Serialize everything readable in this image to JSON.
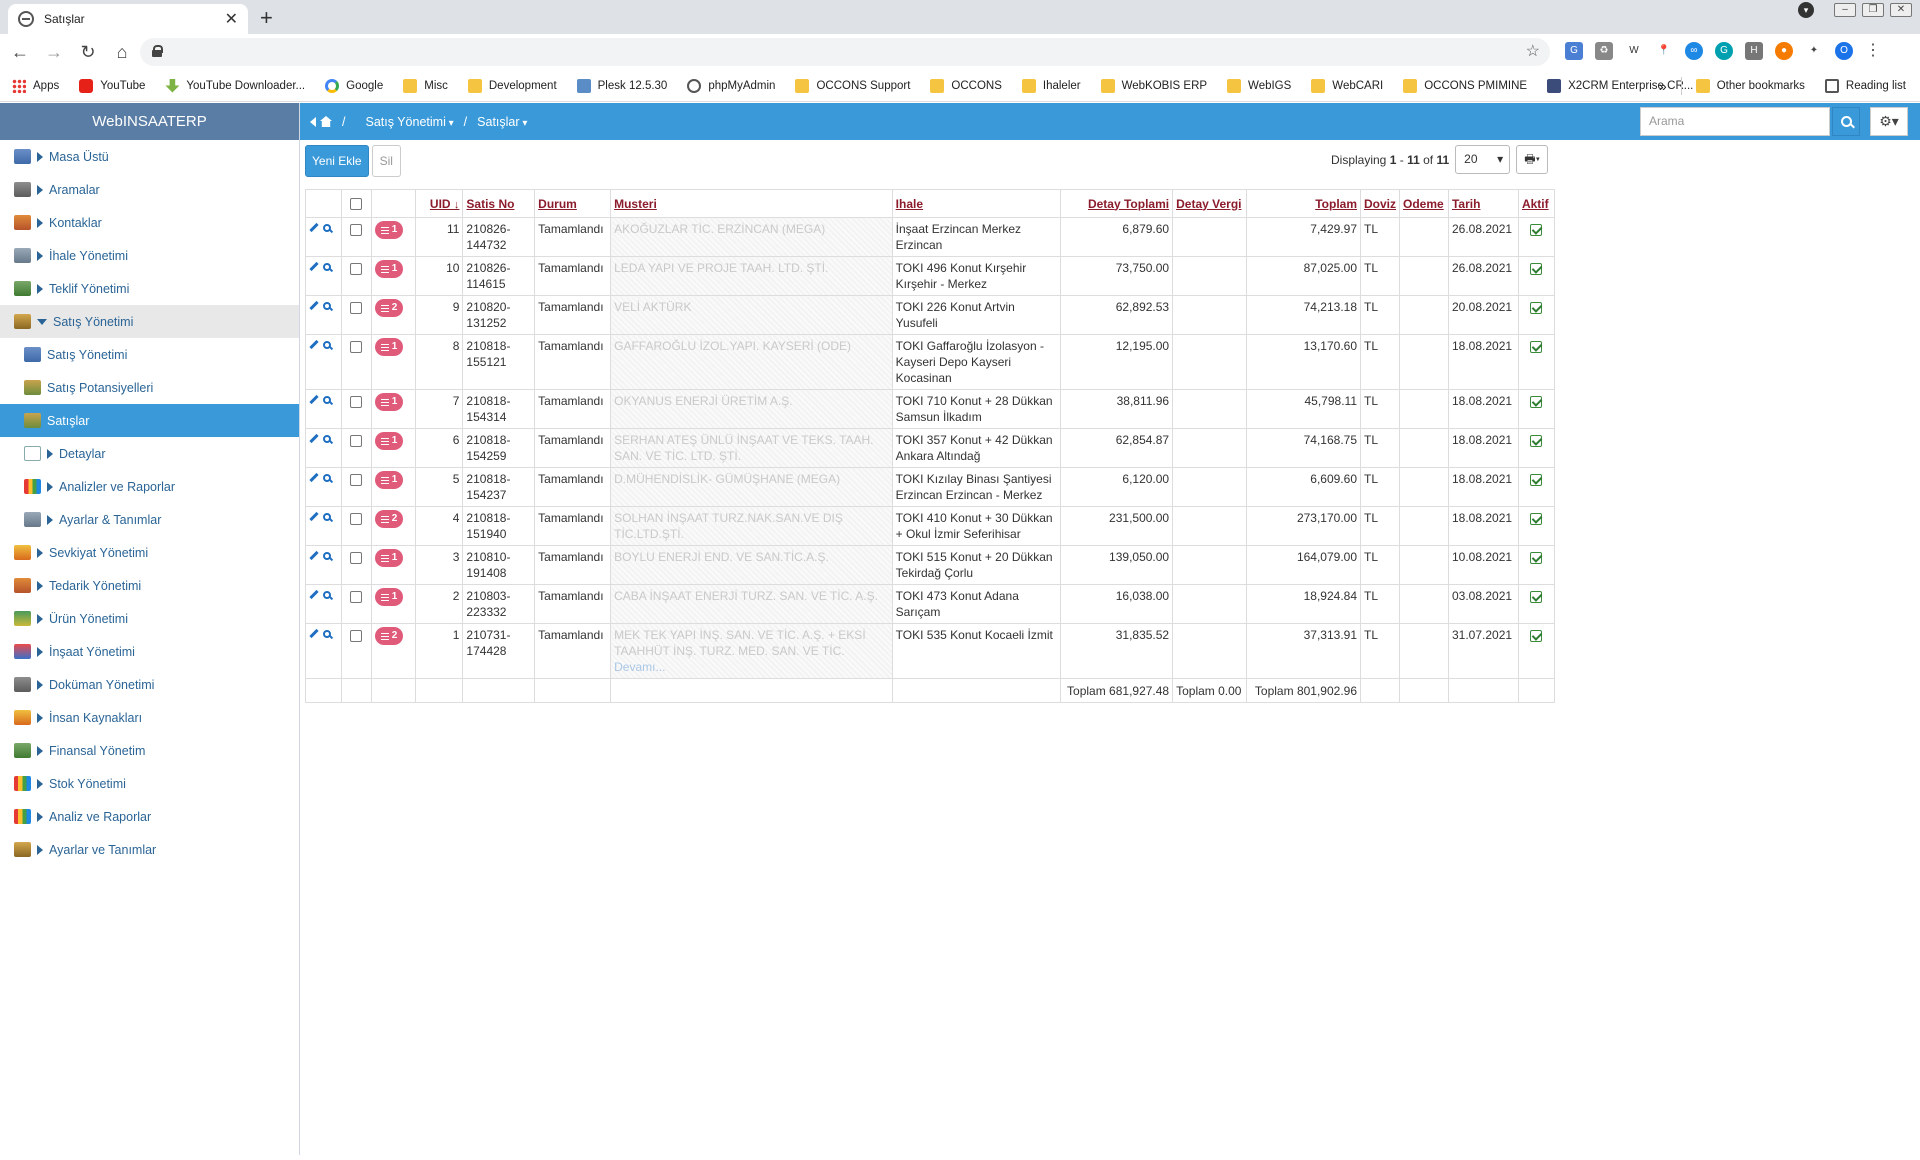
{
  "browser": {
    "tab_title": "Satışlar",
    "bookmarks": [
      {
        "label": "Apps",
        "icon": "grid"
      },
      {
        "label": "YouTube",
        "icon": "yt"
      },
      {
        "label": "YouTube Downloader...",
        "icon": "ytd"
      },
      {
        "label": "Google",
        "icon": "g"
      },
      {
        "label": "Misc",
        "icon": "folder"
      },
      {
        "label": "Development",
        "icon": "folder"
      },
      {
        "label": "Plesk 12.5.30",
        "icon": "plesk"
      },
      {
        "label": "phpMyAdmin",
        "icon": "pma"
      },
      {
        "label": "OCCONS Support",
        "icon": "folder"
      },
      {
        "label": "OCCONS",
        "icon": "folder"
      },
      {
        "label": "Ihaleler",
        "icon": "folder"
      },
      {
        "label": "WebKOBIS ERP",
        "icon": "folder"
      },
      {
        "label": "WebIGS",
        "icon": "folder"
      },
      {
        "label": "WebCARI",
        "icon": "folder"
      },
      {
        "label": "OCCONS PMIMINE",
        "icon": "folder"
      },
      {
        "label": "X2CRM Enterprise CR...",
        "icon": "x2"
      }
    ],
    "overflow": "»",
    "other_bookmarks": "Other bookmarks",
    "reading_list": "Reading list",
    "profile_initial": "O"
  },
  "app": {
    "brand": "WebINSAATERP",
    "menu": [
      {
        "label": "Masa Üstü",
        "icon": "c1",
        "level": 0,
        "state": ""
      },
      {
        "label": "Aramalar",
        "icon": "c2",
        "level": 0,
        "state": ""
      },
      {
        "label": "Kontaklar",
        "icon": "c3",
        "level": 0,
        "state": ""
      },
      {
        "label": "İhale Yönetimi",
        "icon": "c4",
        "level": 0,
        "state": ""
      },
      {
        "label": "Teklif Yönetimi",
        "icon": "c5",
        "level": 0,
        "state": ""
      },
      {
        "label": "Satış Yönetimi",
        "icon": "c6",
        "level": 0,
        "state": "open"
      },
      {
        "label": "Satış Yönetimi",
        "icon": "c1",
        "level": 1,
        "state": "leaf"
      },
      {
        "label": "Satış Potansiyelleri",
        "icon": "c7",
        "level": 1,
        "state": "leaf"
      },
      {
        "label": "Satışlar",
        "icon": "c7",
        "level": 1,
        "state": "selected"
      },
      {
        "label": "Detaylar",
        "icon": "doc",
        "level": 1,
        "state": ""
      },
      {
        "label": "Analizler ve Raporlar",
        "icon": "chart",
        "level": 1,
        "state": ""
      },
      {
        "label": "Ayarlar & Tanımlar",
        "icon": "c4",
        "level": 1,
        "state": ""
      },
      {
        "label": "Sevkiyat Yönetimi",
        "icon": "c8",
        "level": 0,
        "state": ""
      },
      {
        "label": "Tedarik Yönetimi",
        "icon": "c3",
        "level": 0,
        "state": ""
      },
      {
        "label": "Ürün Yönetimi",
        "icon": "c10",
        "level": 0,
        "state": ""
      },
      {
        "label": "İnşaat Yönetimi",
        "icon": "c9",
        "level": 0,
        "state": ""
      },
      {
        "label": "Doküman Yönetimi",
        "icon": "c2",
        "level": 0,
        "state": ""
      },
      {
        "label": "İnsan Kaynakları",
        "icon": "c8",
        "level": 0,
        "state": ""
      },
      {
        "label": "Finansal Yönetim",
        "icon": "c5",
        "level": 0,
        "state": ""
      },
      {
        "label": "Stok Yönetimi",
        "icon": "chart",
        "level": 0,
        "state": ""
      },
      {
        "label": "Analiz ve Raporlar",
        "icon": "chart",
        "level": 0,
        "state": ""
      },
      {
        "label": "Ayarlar ve Tanımlar",
        "icon": "c6",
        "level": 0,
        "state": ""
      }
    ],
    "breadcrumb": {
      "section": "Satış Yönetimi",
      "page": "Satışlar",
      "sep": "/"
    },
    "search_placeholder": "Arama",
    "settings_label": "⚙▾",
    "new_button": "Yeni Ekle",
    "delete_button": "Sil",
    "pager": {
      "prefix": "Displaying",
      "from": "1",
      "dash": "-",
      "to": "11",
      "of": "of",
      "total": "11",
      "page_size": "20"
    },
    "print_label": "🖶▾",
    "columns": [
      "UID",
      "Satis No",
      "Durum",
      "Musteri",
      "Ihale",
      "Detay Toplami",
      "Detay Vergi",
      "Toplam",
      "Doviz",
      "Odeme",
      "Tarih",
      "Aktif"
    ],
    "rows": [
      {
        "badge": "1",
        "uid": "11",
        "no": "210826-144732",
        "durum": "Tamamlandı",
        "musteri": "AKOĞUZLAR TİC. ERZİNCAN (MEGA)",
        "ihale": "İnşaat Erzincan Merkez Erzincan",
        "detay": "6,879.60",
        "vergi": "",
        "toplam": "7,429.97",
        "doviz": "TL",
        "odeme": "",
        "tarih": "26.08.2021"
      },
      {
        "badge": "1",
        "uid": "10",
        "no": "210826-114615",
        "durum": "Tamamlandı",
        "musteri": "LEDA YAPI VE PROJE TAAH. LTD. ŞTİ.",
        "ihale": "TOKI 496 Konut Kırşehir Kırşehir - Merkez",
        "detay": "73,750.00",
        "vergi": "",
        "toplam": "87,025.00",
        "doviz": "TL",
        "odeme": "",
        "tarih": "26.08.2021"
      },
      {
        "badge": "2",
        "uid": "9",
        "no": "210820-131252",
        "durum": "Tamamlandı",
        "musteri": "VELİ AKTÜRK",
        "ihale": "TOKI 226 Konut Artvin Yusufeli",
        "detay": "62,892.53",
        "vergi": "",
        "toplam": "74,213.18",
        "doviz": "TL",
        "odeme": "",
        "tarih": "20.08.2021"
      },
      {
        "badge": "1",
        "uid": "8",
        "no": "210818-155121",
        "durum": "Tamamlandı",
        "musteri": "GAFFAROĞLU İZOL.YAPI. KAYSERİ (ODE)",
        "ihale": "TOKI Gaffaroğlu İzolasyon - Kayseri Depo Kayseri Kocasinan",
        "detay": "12,195.00",
        "vergi": "",
        "toplam": "13,170.60",
        "doviz": "TL",
        "odeme": "",
        "tarih": "18.08.2021"
      },
      {
        "badge": "1",
        "uid": "7",
        "no": "210818-154314",
        "durum": "Tamamlandı",
        "musteri": "OKYANUS ENERJİ ÜRETİM A.Ş.",
        "ihale": "TOKI 710 Konut + 28 Dükkan Samsun İlkadım",
        "detay": "38,811.96",
        "vergi": "",
        "toplam": "45,798.11",
        "doviz": "TL",
        "odeme": "",
        "tarih": "18.08.2021"
      },
      {
        "badge": "1",
        "uid": "6",
        "no": "210818-154259",
        "durum": "Tamamlandı",
        "musteri": "SERHAN ATEŞ ÜNLÜ İNŞAAT VE TEKS. TAAH. SAN. VE TİC. LTD. ŞTİ.",
        "ihale": "TOKI 357 Konut + 42 Dükkan Ankara Altındağ",
        "detay": "62,854.87",
        "vergi": "",
        "toplam": "74,168.75",
        "doviz": "TL",
        "odeme": "",
        "tarih": "18.08.2021"
      },
      {
        "badge": "1",
        "uid": "5",
        "no": "210818-154237",
        "durum": "Tamamlandı",
        "musteri": "D.MÜHENDİSLİK- GÜMÜŞHANE (MEGA)",
        "ihale": "TOKI Kızılay Binası Şantiyesi Erzincan Erzincan - Merkez",
        "detay": "6,120.00",
        "vergi": "",
        "toplam": "6,609.60",
        "doviz": "TL",
        "odeme": "",
        "tarih": "18.08.2021"
      },
      {
        "badge": "2",
        "uid": "4",
        "no": "210818-151940",
        "durum": "Tamamlandı",
        "musteri": "SOLHAN İNŞAAT TURZ.NAK.SAN.VE DIŞ TİC.LTD.ŞTİ.",
        "ihale": "TOKI 410 Konut + 30 Dükkan + Okul İzmir Seferihisar",
        "detay": "231,500.00",
        "vergi": "",
        "toplam": "273,170.00",
        "doviz": "TL",
        "odeme": "",
        "tarih": "18.08.2021"
      },
      {
        "badge": "1",
        "uid": "3",
        "no": "210810-191408",
        "durum": "Tamamlandı",
        "musteri": "BOYLU ENERJİ END. VE SAN.TİC.A.Ş.",
        "ihale": "TOKI 515 Konut + 20 Dükkan Tekirdağ Çorlu",
        "detay": "139,050.00",
        "vergi": "",
        "toplam": "164,079.00",
        "doviz": "TL",
        "odeme": "",
        "tarih": "10.08.2021"
      },
      {
        "badge": "1",
        "uid": "2",
        "no": "210803-223332",
        "durum": "Tamamlandı",
        "musteri": "CABA İNŞAAT ENERJİ TURZ. SAN. VE TİC. A.Ş.",
        "ihale": "TOKI 473 Konut Adana Sarıçam",
        "detay": "16,038.00",
        "vergi": "",
        "toplam": "18,924.84",
        "doviz": "TL",
        "odeme": "",
        "tarih": "03.08.2021"
      },
      {
        "badge": "2",
        "uid": "1",
        "no": "210731-174428",
        "durum": "Tamamlandı",
        "musteri": "MEK TEK YAPI İNŞ. SAN. VE TİC. A.Ş. + EKSİ TAAHHÜT İNŞ. TURZ. MED. SAN. VE TİC.",
        "more": "Devamı...",
        "ihale": "TOKI 535 Konut Kocaeli İzmit",
        "detay": "31,835.52",
        "vergi": "",
        "toplam": "37,313.91",
        "doviz": "TL",
        "odeme": "",
        "tarih": "31.07.2021"
      }
    ],
    "totals": {
      "detay": "Toplam 681,927.48",
      "vergi": "Toplam 0.00",
      "toplam": "Toplam 801,902.96"
    }
  }
}
